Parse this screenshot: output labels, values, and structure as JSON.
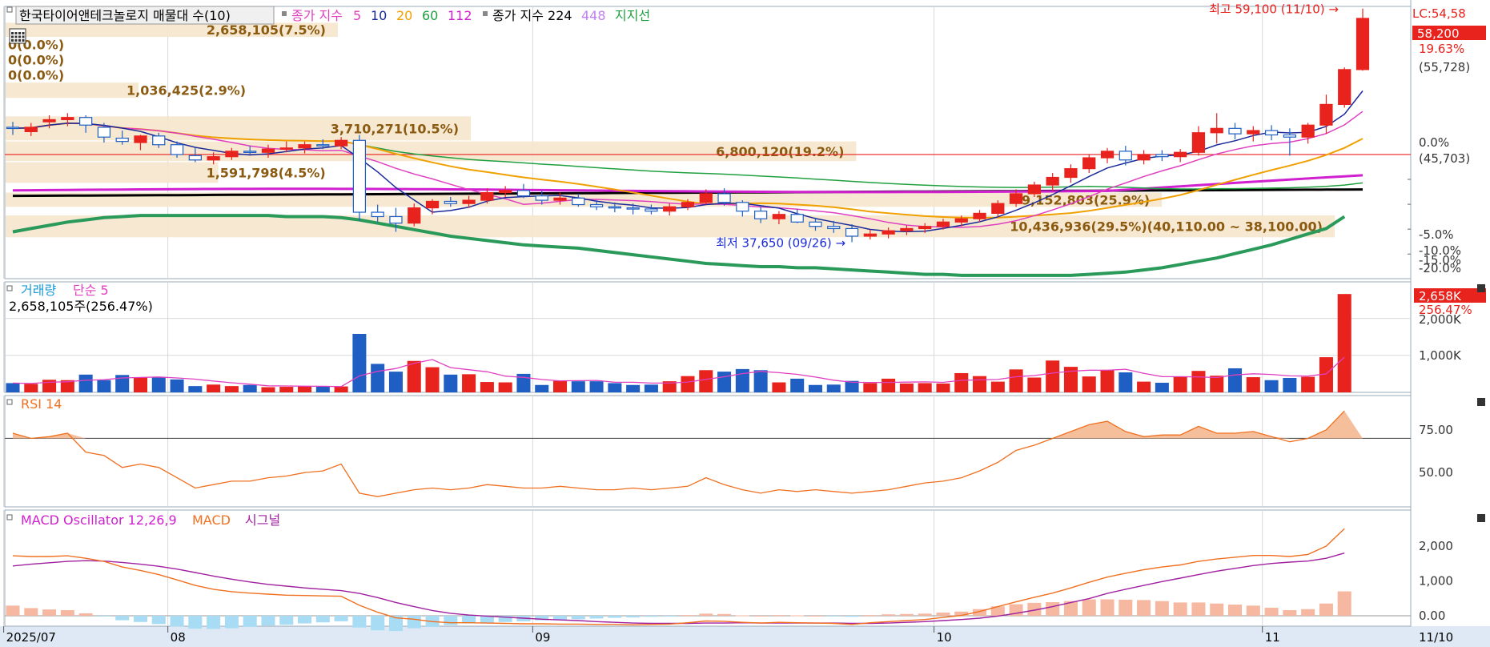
{
  "colors": {
    "up": "#e8221c",
    "down": "#1f5fc4",
    "ma5": "#1a2a9a",
    "ma10": "#e040c0",
    "ma20": "#f0a000",
    "ma60": "#20a040",
    "ma112": "#d020d0",
    "ma224": "#000000",
    "ma448": "#c080f0",
    "ma_long": "#2a9a5a",
    "band": "#f6e6cc",
    "band_text": "#8a5a10",
    "grid": "#d8d8d8",
    "rsi": "#f07020",
    "macd": "#f07020",
    "signal": "#a020a0",
    "osc_pos": "#f6b8a0",
    "osc_neg": "#a8dcf4",
    "vol_ma": "#e040c0"
  },
  "price_panel": {
    "title": "한국타이어앤테크놀로지 매물대 수(10)",
    "legend": [
      {
        "text": "종가 지수",
        "color": "#e040c0"
      },
      {
        "text": "5",
        "color": "#e040c0"
      },
      {
        "text": "10",
        "color": "#1a2a9a"
      },
      {
        "text": "20",
        "color": "#f0a000"
      },
      {
        "text": "60",
        "color": "#20a040"
      },
      {
        "text": "112",
        "color": "#d020d0"
      }
    ],
    "legend2": [
      {
        "text": "종가 지수 224",
        "color": "#000000"
      },
      {
        "text": "448",
        "color": "#c080f0"
      },
      {
        "text": "지지선",
        "color": "#20a040"
      }
    ],
    "right_top": "LC:54,58",
    "current_price": "58,200",
    "current_change": "19.63%",
    "ref_price": "(55,728)",
    "zero_pct": "0.0%",
    "zero_price": "(45,703)",
    "y_ticks": [
      "-5.0%",
      "-10.0%",
      "-15.0%",
      "-20.0%"
    ],
    "high_label": "최고 59,100 (11/10)",
    "low_label": "최저 37,650 (09/26)",
    "bands": [
      {
        "label": "2,658,105(7.5%)",
        "lo": 56500,
        "hi": 57800,
        "width": 0.25
      },
      {
        "label": "0(0.0%)",
        "lo": 55100,
        "hi": 56500,
        "width": 0.0
      },
      {
        "label": "0(0.0%)",
        "lo": 53700,
        "hi": 55100,
        "width": 0.0
      },
      {
        "label": "0(0.0%)",
        "lo": 52300,
        "hi": 53700,
        "width": 0.0
      },
      {
        "label": "1,036,425(2.9%)",
        "lo": 50900,
        "hi": 52300,
        "width": 0.1
      },
      {
        "label": "3,710,271(10.5%)",
        "lo": 47000,
        "hi": 49200,
        "width": 0.35
      },
      {
        "label": "6,800,120(19.2%)",
        "lo": 45100,
        "hi": 46900,
        "width": 0.64
      },
      {
        "label": "1,591,798(4.5%)",
        "lo": 43100,
        "hi": 45000,
        "width": 0.16
      },
      {
        "label": "9,152,803(25.9%)",
        "lo": 40900,
        "hi": 42200,
        "width": 0.87
      },
      {
        "label": "10,436,936(29.5%)(40,110.00 ~ 38,100.00)",
        "lo": 38100,
        "hi": 40110,
        "width": 1.0
      }
    ]
  },
  "volume_panel": {
    "title": "거래량",
    "ma_label": "단순 5",
    "value": "2,658,105주(256.47%)",
    "current": "2,658K",
    "current_pct": "256.47%",
    "y_ticks": [
      "2,000K",
      "1,000K"
    ]
  },
  "rsi_panel": {
    "title": "RSI 14",
    "y_ticks": [
      "75.00",
      "50.00"
    ]
  },
  "macd_panel": {
    "title": "MACD Oscillator 12,26,9",
    "macd_label": "MACD",
    "signal_label": "시그널",
    "y_ticks": [
      "2,000",
      "1,000",
      "0.00"
    ]
  },
  "x_axis": {
    "labels": [
      {
        "text": "2025/07",
        "index": 0
      },
      {
        "text": "08",
        "index": 9
      },
      {
        "text": "09",
        "index": 29
      },
      {
        "text": "10",
        "index": 51
      },
      {
        "text": "11",
        "index": 69
      }
    ],
    "end_label": "11/10"
  },
  "chart_data": {
    "type": "candlestick",
    "ohlc": [
      [
        48200,
        48700,
        47500,
        48100
      ],
      [
        47800,
        48600,
        47400,
        48200
      ],
      [
        48700,
        49300,
        48100,
        48900
      ],
      [
        48900,
        49500,
        48300,
        49100
      ],
      [
        49100,
        49300,
        47700,
        48400
      ],
      [
        48200,
        48600,
        46800,
        47300
      ],
      [
        47200,
        47900,
        46600,
        46900
      ],
      [
        46800,
        47500,
        46100,
        47400
      ],
      [
        47400,
        47700,
        46300,
        46600
      ],
      [
        46600,
        46900,
        45400,
        45700
      ],
      [
        45600,
        46300,
        45000,
        45200
      ],
      [
        45200,
        45900,
        44800,
        45500
      ],
      [
        45500,
        46300,
        45200,
        46000
      ],
      [
        46000,
        46500,
        45600,
        45900
      ],
      [
        45900,
        46600,
        45400,
        46200
      ],
      [
        46200,
        46900,
        45900,
        46300
      ],
      [
        46300,
        46900,
        45800,
        46600
      ],
      [
        46600,
        47100,
        46200,
        46500
      ],
      [
        46500,
        47300,
        46200,
        47000
      ],
      [
        47000,
        47500,
        39600,
        40400
      ],
      [
        40400,
        41100,
        39500,
        40000
      ],
      [
        40000,
        40800,
        38600,
        39400
      ],
      [
        39400,
        41200,
        39100,
        40800
      ],
      [
        40800,
        41600,
        40200,
        41400
      ],
      [
        41400,
        41800,
        40900,
        41200
      ],
      [
        41200,
        41900,
        40800,
        41500
      ],
      [
        41500,
        42600,
        41200,
        42200
      ],
      [
        42200,
        42800,
        41800,
        42400
      ],
      [
        42400,
        43000,
        41700,
        41900
      ],
      [
        41900,
        42400,
        41100,
        41500
      ],
      [
        41500,
        42200,
        41100,
        41700
      ],
      [
        41700,
        42100,
        40900,
        41100
      ],
      [
        41100,
        41500,
        40600,
        40900
      ],
      [
        40900,
        41300,
        40400,
        40800
      ],
      [
        40800,
        41200,
        40200,
        40700
      ],
      [
        40700,
        41100,
        40200,
        40500
      ],
      [
        40500,
        41200,
        40100,
        40900
      ],
      [
        40900,
        41600,
        40600,
        41300
      ],
      [
        41300,
        42500,
        41100,
        42100
      ],
      [
        42100,
        42600,
        41000,
        41300
      ],
      [
        41300,
        41500,
        40000,
        40500
      ],
      [
        40500,
        40900,
        39400,
        39800
      ],
      [
        39800,
        40500,
        39300,
        40200
      ],
      [
        40200,
        40700,
        39400,
        39500
      ],
      [
        39500,
        39900,
        38700,
        39100
      ],
      [
        39100,
        39600,
        38500,
        38900
      ],
      [
        38900,
        39300,
        37650,
        38200
      ],
      [
        38200,
        38800,
        37900,
        38400
      ],
      [
        38400,
        39000,
        38000,
        38700
      ],
      [
        38700,
        39200,
        38300,
        38900
      ],
      [
        38900,
        39400,
        38500,
        39100
      ],
      [
        39100,
        39800,
        38800,
        39500
      ],
      [
        39500,
        40100,
        39100,
        39800
      ],
      [
        39800,
        40600,
        39500,
        40300
      ],
      [
        40300,
        41500,
        40000,
        41200
      ],
      [
        41200,
        42500,
        40900,
        42100
      ],
      [
        42100,
        43200,
        41800,
        42900
      ],
      [
        42900,
        44000,
        42400,
        43600
      ],
      [
        43600,
        44800,
        43100,
        44400
      ],
      [
        44400,
        45700,
        44000,
        45400
      ],
      [
        45400,
        46300,
        44900,
        46000
      ],
      [
        46000,
        46500,
        44700,
        45200
      ],
      [
        45200,
        46100,
        44800,
        45700
      ],
      [
        45700,
        46100,
        45100,
        45500
      ],
      [
        45500,
        46200,
        45000,
        45900
      ],
      [
        45900,
        48300,
        45600,
        47700
      ],
      [
        47700,
        49500,
        46700,
        48100
      ],
      [
        48100,
        48600,
        47100,
        47600
      ],
      [
        47600,
        48300,
        46900,
        47900
      ],
      [
        47900,
        48400,
        47000,
        47500
      ],
      [
        47500,
        48100,
        45600,
        47300
      ],
      [
        47300,
        48600,
        46700,
        48400
      ],
      [
        48400,
        51200,
        47600,
        50300
      ],
      [
        50300,
        53700,
        50000,
        53500
      ],
      [
        53500,
        59100,
        53400,
        58200
      ]
    ],
    "volume_k": [
      250,
      230,
      340,
      330,
      480,
      330,
      470,
      400,
      400,
      350,
      170,
      210,
      170,
      200,
      140,
      150,
      170,
      160,
      160,
      1580,
      770,
      560,
      850,
      680,
      480,
      490,
      280,
      270,
      500,
      200,
      310,
      300,
      300,
      250,
      200,
      210,
      300,
      440,
      600,
      560,
      630,
      600,
      270,
      370,
      200,
      210,
      310,
      250,
      370,
      240,
      250,
      240,
      520,
      440,
      290,
      620,
      400,
      860,
      690,
      430,
      610,
      540,
      290,
      260,
      420,
      580,
      450,
      650,
      410,
      330,
      390,
      420,
      950,
      2658
    ],
    "rsi": [
      73,
      70,
      71,
      73,
      62,
      60,
      53,
      55,
      53,
      47,
      41,
      43,
      45,
      45,
      47,
      48,
      50,
      51,
      55,
      38,
      36,
      38,
      40,
      41,
      40,
      41,
      43,
      42,
      41,
      41,
      42,
      41,
      40,
      40,
      41,
      40,
      41,
      42,
      47,
      43,
      40,
      38,
      40,
      39,
      40,
      39,
      38,
      39,
      40,
      42,
      44,
      45,
      47,
      51,
      56,
      63,
      66,
      70,
      74,
      78,
      80,
      74,
      71,
      72,
      72,
      77,
      73,
      73,
      74,
      71,
      68,
      70,
      75,
      86
    ],
    "macd": [
      1720,
      1700,
      1700,
      1720,
      1650,
      1560,
      1400,
      1300,
      1180,
      1030,
      870,
      760,
      690,
      650,
      620,
      590,
      580,
      570,
      560,
      300,
      100,
      -60,
      -100,
      -170,
      -200,
      -200,
      -210,
      -220,
      -230,
      -230,
      -240,
      -240,
      -250,
      -250,
      -260,
      -250,
      -240,
      -200,
      -150,
      -160,
      -190,
      -210,
      -190,
      -200,
      -210,
      -220,
      -250,
      -200,
      -170,
      -140,
      -110,
      -50,
      10,
      120,
      260,
      400,
      530,
      650,
      800,
      960,
      1110,
      1220,
      1320,
      1400,
      1460,
      1560,
      1630,
      1680,
      1730,
      1730,
      1700,
      1760,
      2000,
      2500
    ],
    "signal": [
      1430,
      1480,
      1520,
      1560,
      1580,
      1570,
      1530,
      1480,
      1420,
      1340,
      1240,
      1140,
      1050,
      970,
      900,
      850,
      800,
      760,
      720,
      640,
      520,
      380,
      260,
      150,
      70,
      20,
      -10,
      -40,
      -70,
      -100,
      -120,
      -140,
      -170,
      -190,
      -210,
      -220,
      -220,
      -220,
      -210,
      -210,
      -200,
      -210,
      -210,
      -210,
      -210,
      -210,
      -220,
      -220,
      -210,
      -190,
      -170,
      -140,
      -110,
      -70,
      -10,
      70,
      160,
      260,
      380,
      490,
      640,
      760,
      870,
      980,
      1080,
      1180,
      1280,
      1360,
      1440,
      1500,
      1540,
      1570,
      1650,
      1800
    ],
    "ma_long": [
      38600,
      38900,
      39200,
      39500,
      39700,
      39900,
      40000,
      40100,
      40100,
      40100,
      40100,
      40100,
      40100,
      40100,
      40100,
      40000,
      40000,
      40000,
      39900,
      39700,
      39400,
      39100,
      38800,
      38500,
      38200,
      38000,
      37800,
      37600,
      37400,
      37300,
      37200,
      37100,
      36900,
      36700,
      36500,
      36300,
      36100,
      35900,
      35700,
      35600,
      35500,
      35400,
      35400,
      35300,
      35300,
      35200,
      35100,
      35000,
      34900,
      34800,
      34700,
      34700,
      34600,
      34600,
      34600,
      34600,
      34600,
      34600,
      34600,
      34700,
      34800,
      34900,
      35100,
      35300,
      35600,
      35900,
      36200,
      36600,
      37000,
      37400,
      37900,
      38400,
      38900,
      40000
    ],
    "y_range": [
      34300,
      59300
    ],
    "volume_max_k": 2900,
    "rsi_range": [
      30,
      95
    ],
    "macd_range": [
      -300,
      2850
    ]
  }
}
